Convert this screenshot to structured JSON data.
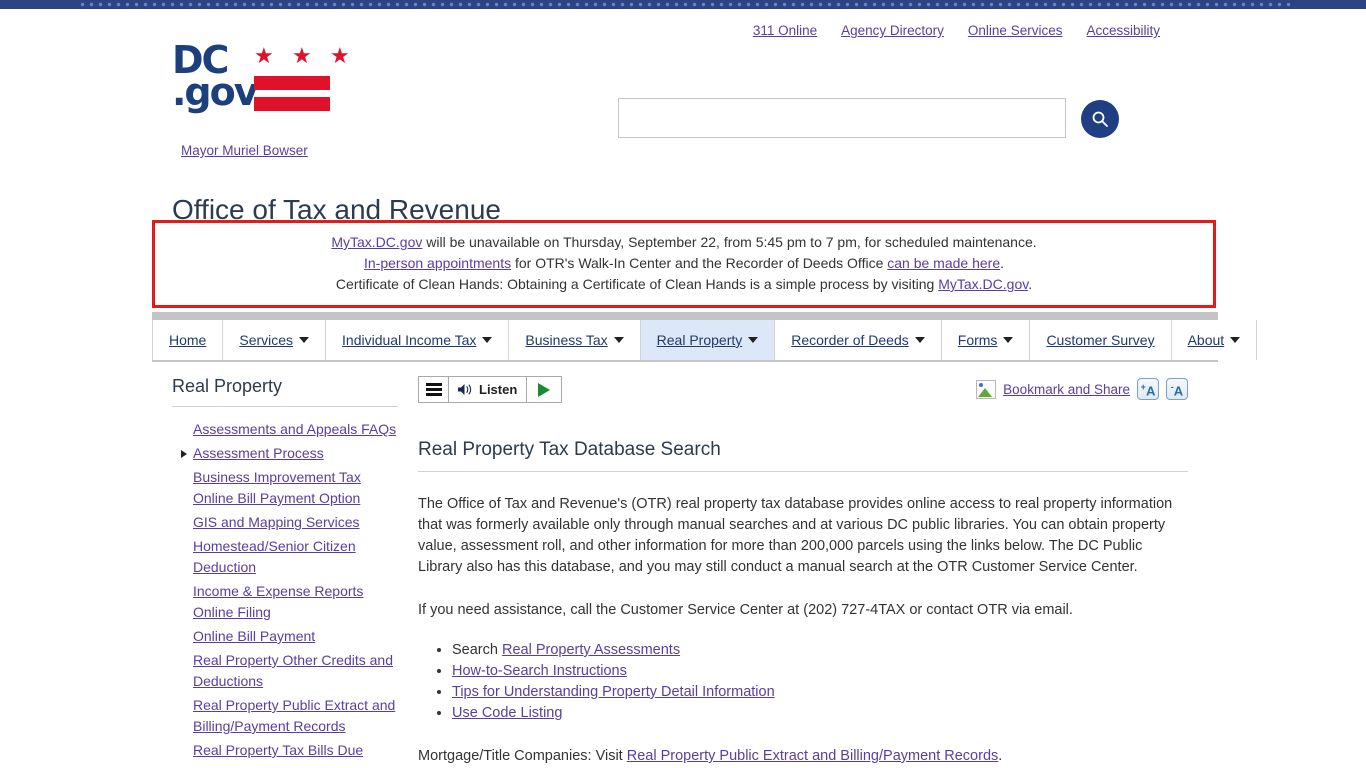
{
  "utility_nav": [
    {
      "label": "311 Online"
    },
    {
      "label": "Agency Directory"
    },
    {
      "label": "Online Services"
    },
    {
      "label": "Accessibility"
    }
  ],
  "logo": {
    "dc_text": "DC",
    "gov_text": ".gov",
    "mayor_link": "Mayor Muriel Bowser",
    "flag_color": "#e0112b",
    "text_color": "#1d3f7e"
  },
  "search": {
    "value": "",
    "placeholder": "",
    "button_icon": "search-icon",
    "button_color": "#1f3f82"
  },
  "site_title": "Office of Tax and Revenue",
  "alert": {
    "border_color": "#e31b1b",
    "lines": [
      {
        "parts": [
          {
            "text": "MyTax.DC.gov",
            "link": true
          },
          {
            "text": " will be unavailable on Thursday, September 22, from 5:45 pm to 7 pm, for scheduled maintenance.",
            "link": false
          }
        ]
      },
      {
        "parts": [
          {
            "text": "In-person appointments",
            "link": true
          },
          {
            "text": " for OTR's Walk-In Center and the Recorder of Deeds Office ",
            "link": false
          },
          {
            "text": "can be made here",
            "link": true
          },
          {
            "text": ".",
            "link": false
          }
        ]
      },
      {
        "parts": [
          {
            "text": "Certificate of Clean Hands: Obtaining a Certificate of Clean Hands is a simple process by visiting ",
            "link": false
          },
          {
            "text": "MyTax.DC.gov",
            "link": true
          },
          {
            "text": ".",
            "link": false
          }
        ]
      }
    ]
  },
  "main_nav": [
    {
      "label": "Home",
      "caret": false,
      "active": false
    },
    {
      "label": "Services",
      "caret": true,
      "active": false
    },
    {
      "label": "Individual Income Tax",
      "caret": true,
      "active": false
    },
    {
      "label": "Business Tax",
      "caret": true,
      "active": false
    },
    {
      "label": "Real Property",
      "caret": true,
      "active": true
    },
    {
      "label": "Recorder of Deeds",
      "caret": true,
      "active": false
    },
    {
      "label": "Forms",
      "caret": true,
      "active": false
    },
    {
      "label": "Customer Survey",
      "caret": false,
      "active": false
    },
    {
      "label": "About",
      "caret": true,
      "active": false
    }
  ],
  "sidebar": {
    "title": "Real Property",
    "items": [
      {
        "label": "Assessments and Appeals FAQs",
        "marker": false
      },
      {
        "label": "Assessment Process",
        "marker": true
      },
      {
        "label": "Business Improvement Tax Online Bill Payment Option",
        "marker": false
      },
      {
        "label": "GIS and Mapping Services",
        "marker": false
      },
      {
        "label": "Homestead/Senior Citizen Deduction",
        "marker": false
      },
      {
        "label": "Income & Expense Reports Online Filing",
        "marker": false
      },
      {
        "label": "Online Bill Payment",
        "marker": false
      },
      {
        "label": "Real Property Other Credits and Deductions",
        "marker": false
      },
      {
        "label": "Real Property Public Extract and Billing/Payment Records",
        "marker": false
      },
      {
        "label": "Real Property Tax Bills Due",
        "marker": false
      }
    ]
  },
  "toolbar": {
    "listen_label": "Listen",
    "menu_icon": "hamburger-icon",
    "speaker_icon": "speaker-icon",
    "play_icon": "play-icon",
    "play_color": "#1a8a35",
    "bookmark_label": "Bookmark and Share",
    "font_increase_label": "A",
    "font_increase_sup": "+",
    "font_decrease_label": "A",
    "font_decrease_sup": "-"
  },
  "main": {
    "title": "Real Property Tax Database Search",
    "paragraph1": "The Office of Tax and Revenue's (OTR) real property tax database provides online access to real property information that was formerly available only through manual searches and at various DC public libraries. You can obtain property value, assessment roll, and other information for more than 200,000 parcels using the links below. The DC Public Library also has this database, and you may still conduct a manual search at the OTR Customer Service Center.",
    "paragraph2": "If you need assistance, call the Customer Service Center at (202) 727-4TAX or contact OTR via email.",
    "list": [
      {
        "prefix": "Search ",
        "link": "Real Property Assessments",
        "suffix": ""
      },
      {
        "prefix": "",
        "link": "How-to-Search Instructions",
        "suffix": ""
      },
      {
        "prefix": "",
        "link": "Tips for Understanding Property Detail Information",
        "suffix": ""
      },
      {
        "prefix": "",
        "link": "Use Code Listing",
        "suffix": ""
      }
    ],
    "footer_prefix": "Mortgage/Title Companies: Visit ",
    "footer_link": "Real Property Public Extract and Billing/Payment Records",
    "footer_suffix": "."
  }
}
